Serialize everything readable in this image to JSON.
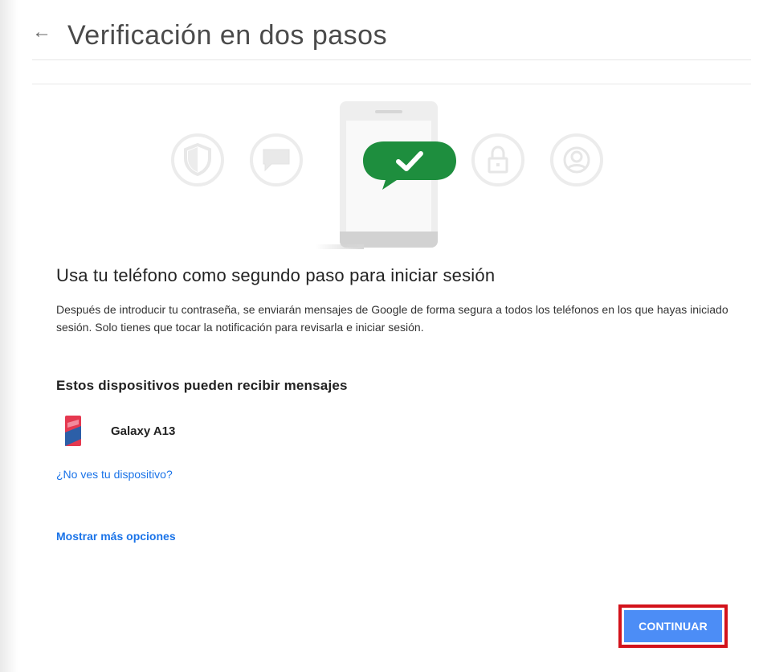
{
  "header": {
    "title": "Verificación en dos pasos",
    "back_icon": "arrow-left-icon"
  },
  "illustration": {
    "icons": [
      "shield-icon",
      "chat-bubble-icon",
      "phone-icon",
      "checkmark-bubble-icon",
      "lock-icon",
      "account-circle-icon"
    ],
    "accent_color": "#1e8e3e"
  },
  "main": {
    "heading": "Usa tu teléfono como segundo paso para iniciar sesión",
    "description": "Después de introducir tu contraseña, se enviarán mensajes de Google de forma segura a todos los teléfonos en los que hayas iniciado sesión. Solo tienes que tocar la notificación para revisarla e iniciar sesión.",
    "devices_heading": "Estos dispositivos pueden recibir mensajes",
    "devices": [
      {
        "name": "Galaxy A13",
        "icon": "smartphone-icon"
      }
    ],
    "missing_device_link": "¿No ves tu dispositivo?",
    "more_options_link": "Mostrar más opciones"
  },
  "actions": {
    "continue_label": "CONTINUAR",
    "continue_color": "#4c8df6",
    "highlight_color": "#d3121b"
  }
}
